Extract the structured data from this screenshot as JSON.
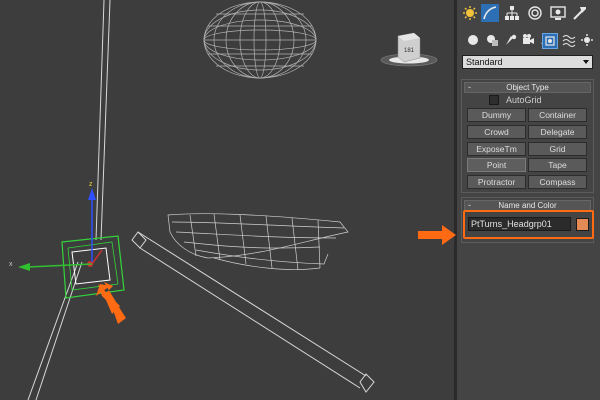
{
  "viewport": {
    "cube_label": "181",
    "axis_z": "z",
    "axis_x": "x"
  },
  "command_panel": {
    "tabs": [
      {
        "name": "create-icon"
      },
      {
        "name": "modify-icon"
      },
      {
        "name": "hierarchy-icon"
      },
      {
        "name": "motion-icon"
      },
      {
        "name": "display-icon"
      },
      {
        "name": "utilities-icon"
      }
    ],
    "sub_categories": [
      {
        "name": "geometry-icon"
      },
      {
        "name": "shapes-icon"
      },
      {
        "name": "lights-icon"
      },
      {
        "name": "cameras-icon"
      },
      {
        "name": "helpers-icon"
      },
      {
        "name": "space-warps-icon"
      },
      {
        "name": "systems-icon"
      }
    ],
    "category_select": "Standard",
    "object_type": {
      "title": "Object Type",
      "minus": "-",
      "autogrid_label": "AutoGrid",
      "buttons": [
        "Dummy",
        "Container",
        "Crowd",
        "Delegate",
        "ExposeTm",
        "Grid",
        "Point",
        "Tape",
        "Protractor",
        "Compass"
      ]
    },
    "name_and_color": {
      "title": "Name and Color",
      "minus": "-",
      "name_value": "PtTurns_Headgrp01",
      "swatch_color": "#e38a56"
    }
  },
  "colors": {
    "highlight": "#ff6a13",
    "accent_callout": "#ff6a13",
    "selection_green": "#33d43a"
  }
}
